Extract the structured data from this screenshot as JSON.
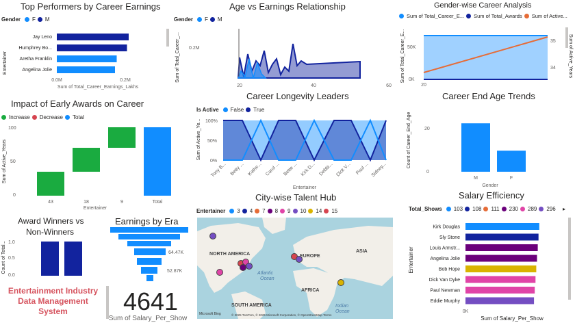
{
  "colors": {
    "navy": "#12239e",
    "blue": "#118dff",
    "orange": "#e66c37",
    "green": "#1aab40",
    "red": "#d64550",
    "purple": "#6b007b",
    "magenta": "#e044a7",
    "darkviolet": "#744ec2",
    "gold": "#d9b300",
    "title_red": "#d6545f"
  },
  "top_performers": {
    "title": "Top Performers by Career Earnings",
    "legend_title": "Gender",
    "legend": [
      "F",
      "M"
    ],
    "ylabel": "Entertainer",
    "xlabel": "Sum of Total_Career_Earnings_Lakhs",
    "xticks": [
      "0.0M",
      "0.2M"
    ],
    "chart_data": {
      "type": "bar",
      "categories": [
        "Jay Leno",
        "Humphrey Bo...",
        "Aretha Franklin",
        "Angelina Jolie"
      ],
      "values": [
        0.21,
        0.205,
        0.175,
        0.17
      ],
      "colors": [
        "#12239e",
        "#12239e",
        "#118dff",
        "#118dff"
      ],
      "xlim": [
        0,
        0.25
      ]
    }
  },
  "age_earnings": {
    "title": "Age vs Earnings Relationship",
    "legend_title": "Gender",
    "legend": [
      "F",
      "M"
    ],
    "ylabel": "Sum of Total_Career_...",
    "ytick": "0.2M",
    "xticks": [
      "20",
      "40",
      "60"
    ]
  },
  "gender_career": {
    "title": "Gender-wise Career Analysis",
    "legend": [
      "Sum of Total_Career_E...",
      "Sum of Total_Awards",
      "Sum of Active..."
    ],
    "ylabel_left": "Sum of Total_Career_E...",
    "ylabel_right": "Sum of Active_Years",
    "yticks_left": [
      "50K",
      "0K"
    ],
    "yticks_right": [
      "35",
      "34"
    ],
    "xtick": "20"
  },
  "early_awards": {
    "title": "Impact of Early Awards on Career",
    "legend": [
      "Increase",
      "Decrease",
      "Total"
    ],
    "ylabel": "Sum of Active_Years",
    "xlabel": "Entertainer",
    "yticks": [
      "100",
      "50",
      "0"
    ],
    "chart_data": {
      "type": "waterfall",
      "categories": [
        "43",
        "18",
        "9",
        "Total"
      ],
      "values": [
        35,
        35,
        30,
        100
      ],
      "ylim": [
        0,
        100
      ]
    }
  },
  "longevity": {
    "title": "Career Longevity Leaders",
    "legend_title": "Is Active",
    "legend": [
      "False",
      "True"
    ],
    "ylabel": "Sum of Active_Ye...",
    "xlabel": "Entertainer",
    "yticks": [
      "100%",
      "50%",
      "0%"
    ],
    "categories": [
      "Tony B...",
      "Betty ...",
      "Kathe...",
      "Carol ...",
      "Bette ...",
      "Kirk D...",
      "Debbi...",
      "Dick V...",
      "Paul ...",
      "Sidney..."
    ]
  },
  "end_age": {
    "title": "Career End Age Trends",
    "ylabel": "Count of Career_End_Age",
    "xlabel": "Gender",
    "yticks": [
      "20",
      "0"
    ],
    "chart_data": {
      "type": "bar",
      "categories": [
        "M",
        "F"
      ],
      "values": [
        23,
        10
      ],
      "ylim": [
        0,
        26
      ]
    }
  },
  "award_winners": {
    "title_line1": "Award Winners vs",
    "title_line2": "Non-Winners",
    "ylabel": "Count of Total...",
    "yticks": [
      "1.0",
      "0.5",
      "0.0"
    ],
    "chart_data": {
      "type": "bar",
      "categories": [
        "",
        ""
      ],
      "values": [
        1,
        1
      ]
    }
  },
  "era": {
    "title": "Earnings by Era",
    "labels": [
      "64.47K",
      "52.87K"
    ],
    "chart_data": {
      "type": "funnel",
      "labels_shown": [
        64470,
        52870
      ]
    }
  },
  "app_title": {
    "line1": "Entertainment Industry",
    "line2": "Data Management",
    "line3": "System"
  },
  "kpi": {
    "value": "4641",
    "label": "Sum of Salary_Per_Show"
  },
  "city": {
    "title": "City-wise Talent Hub",
    "legend_title": "Entertainer",
    "legend": [
      {
        "label": "3",
        "color": "#118dff"
      },
      {
        "label": "4",
        "color": "#12239e"
      },
      {
        "label": "7",
        "color": "#e66c37"
      },
      {
        "label": "8",
        "color": "#6b007b"
      },
      {
        "label": "9",
        "color": "#e044a7"
      },
      {
        "label": "10",
        "color": "#744ec2"
      },
      {
        "label": "14",
        "color": "#d9b300"
      },
      {
        "label": "15",
        "color": "#d64550"
      }
    ],
    "regions": [
      "NORTH AMERICA",
      "EUROPE",
      "ASIA",
      "AFRICA",
      "SOUTH AMERICA"
    ],
    "oceans": [
      "Atlantic",
      "Ocean",
      "Indian",
      "Ocean"
    ],
    "attribution": "© 2025 TomTom, © 2025 Microsoft Corporation, © OpenStreetMap  Terms",
    "brand": "Microsoft Bing"
  },
  "salary": {
    "title": "Salary Efficiency",
    "legend_title": "Total_Shows",
    "legend": [
      {
        "label": "103",
        "color": "#118dff"
      },
      {
        "label": "108",
        "color": "#12239e"
      },
      {
        "label": "111",
        "color": "#e66c37"
      },
      {
        "label": "230",
        "color": "#6b007b"
      },
      {
        "label": "289",
        "color": "#e044a7"
      },
      {
        "label": "296",
        "color": "#744ec2"
      }
    ],
    "ylabel": "Entertainer",
    "xlabel": "Sum of Salary_Per_Show",
    "xtick": "0K",
    "chart_data": {
      "type": "bar",
      "categories": [
        "Kirk Douglas",
        "Sly Stone",
        "Louis Armstr...",
        "Angelina Jolie",
        "Bob Hope",
        "Dick Van Dyke",
        "Paul Newman",
        "Eddie Murphy"
      ],
      "values": [
        98,
        97,
        96,
        95,
        94,
        93,
        92,
        91
      ],
      "colors": [
        "#118dff",
        "#12239e",
        "#6b007b",
        "#6b007b",
        "#d9b300",
        "#e044a7",
        "#e044a7",
        "#744ec2"
      ]
    }
  }
}
